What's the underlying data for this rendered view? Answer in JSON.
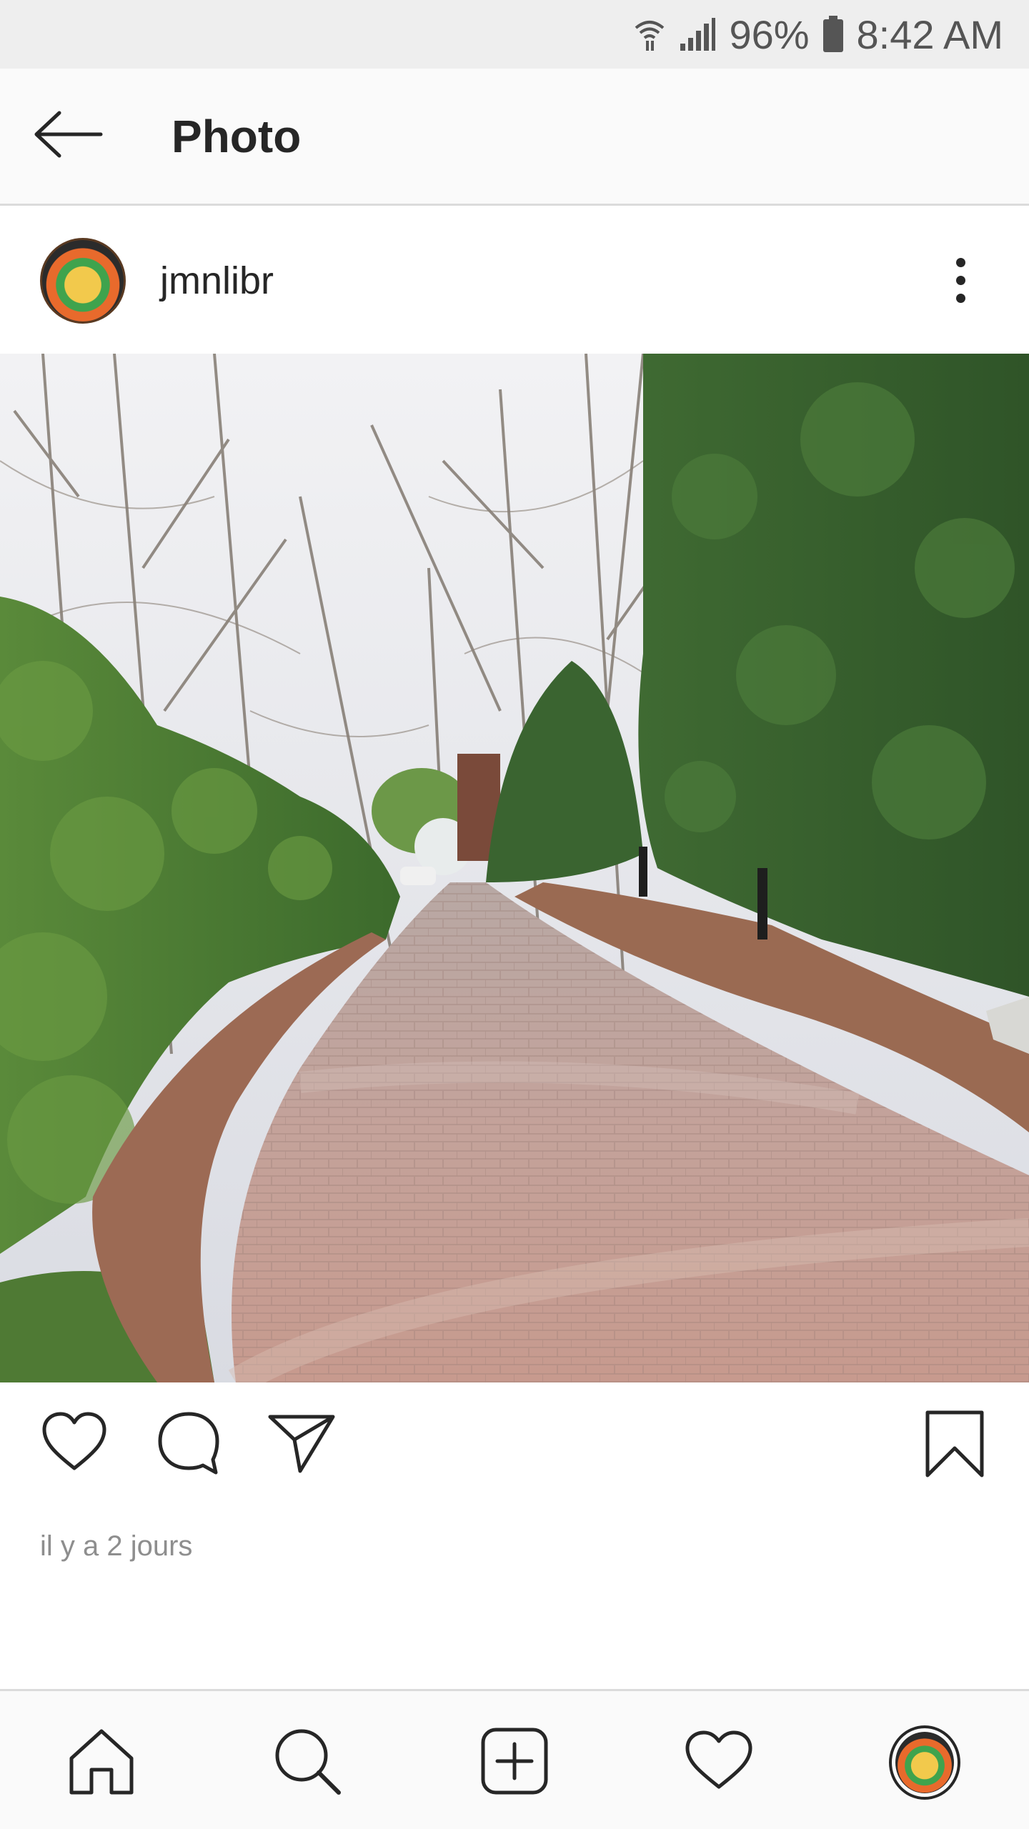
{
  "status_bar": {
    "battery": "96%",
    "time": "8:42 AM",
    "icons": [
      "wifi-icon",
      "signal-icon",
      "battery-icon"
    ]
  },
  "header": {
    "title": "Photo",
    "back_icon": "arrow-left-icon"
  },
  "post": {
    "username": "jmnlibr",
    "menu_icon": "more-vertical-icon",
    "photo_subject": "brick-paved walkway lined with hedges and bare trees",
    "actions": [
      "heart-icon",
      "comment-icon",
      "share-icon",
      "bookmark-icon"
    ],
    "timestamp": "il y a 2 jours"
  },
  "bottom_nav": {
    "items": [
      "home-icon",
      "search-icon",
      "add-post-icon",
      "activity-heart-icon",
      "profile-avatar"
    ]
  },
  "colors": {
    "text": "#262626",
    "secondary_text": "#8e8e8e",
    "divider": "#dbdbdb",
    "status_bar_bg": "#eeeeee"
  }
}
